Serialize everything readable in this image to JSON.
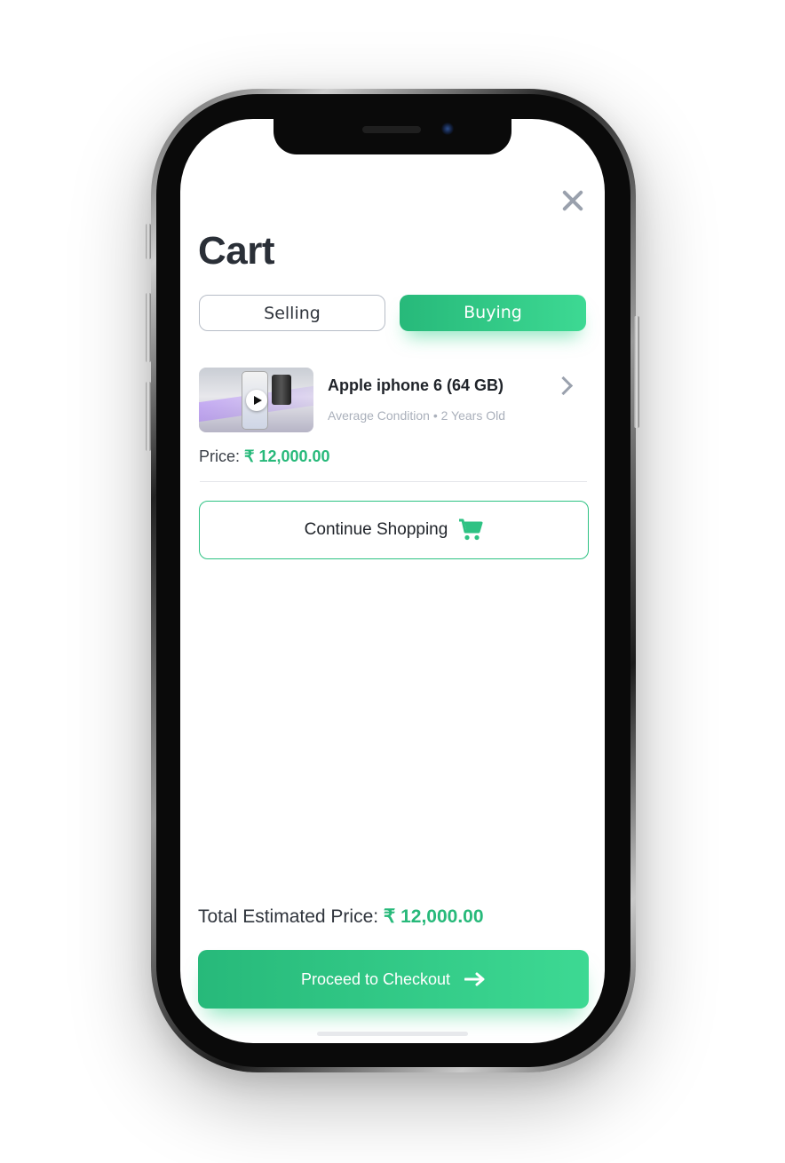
{
  "app": {
    "title": "Cart"
  },
  "tabs": [
    {
      "label": "Selling",
      "active": false
    },
    {
      "label": "Buying",
      "active": true
    }
  ],
  "cart_item": {
    "thumbnail": "product-video-thumbnail",
    "name": "Apple iphone 6 (64 GB)",
    "meta": "Average Condition • 2 Years Old",
    "price_label": "Price: ",
    "price_value": "₹ 12,000.00"
  },
  "continue": {
    "label": "Continue Shopping",
    "icon": "shopping-cart-icon"
  },
  "total": {
    "label": "Total Estimated Price: ",
    "value": "₹ 12,000.00"
  },
  "checkout": {
    "label": "Proceed to Checkout",
    "icon": "arrow-right-icon"
  },
  "colors": {
    "accent": "#2ec283",
    "accent_light": "#3dd993",
    "title_text": "#2a2f37",
    "muted_text": "#aab0bb"
  }
}
